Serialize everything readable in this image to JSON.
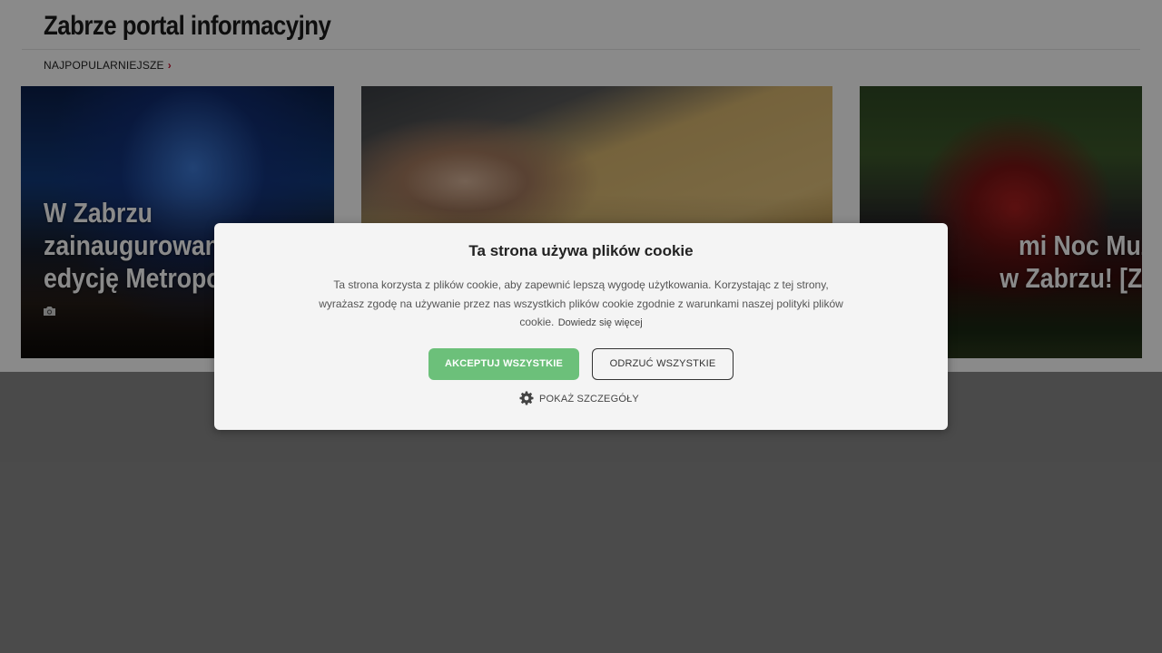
{
  "site": {
    "title": "Zabrze portal informacyjny",
    "section_link": "NAJPOPULARNIEJSZE",
    "section_chevron": "›"
  },
  "articles": [
    {
      "title_lines": [
        "W Zabrzu",
        "zainaugurowano",
        "edycję Metropoli"
      ],
      "icon": "camera-icon"
    },
    {
      "title_lines": [],
      "icon": ""
    },
    {
      "title_lines": [
        "mi Noc Muzeów",
        "w Zabrzu! [ZDJĘCIA"
      ],
      "icon": ""
    }
  ],
  "cookie_banner": {
    "heading": "Ta strona używa plików cookie",
    "body": "Ta strona korzysta z plików cookie, aby zapewnić lepszą wygodę użytkowania. Korzystając z tej strony, wyrażasz zgodę na używanie przez nas wszystkich plików cookie zgodnie z warunkami naszej polityki plików cookie.",
    "learn_more": "Dowiedz się więcej",
    "accept_label": "AKCEPTUJ WSZYSTKIE",
    "reject_label": "ODRZUĆ WSZYSTKIE",
    "details_label": "POKAŻ SZCZEGÓŁY",
    "details_icon": "gear-icon"
  },
  "colors": {
    "accent_chevron": "#c8102e",
    "accept_button": "#6cc07a",
    "overlay": "rgba(0,0,0,0.46)"
  }
}
